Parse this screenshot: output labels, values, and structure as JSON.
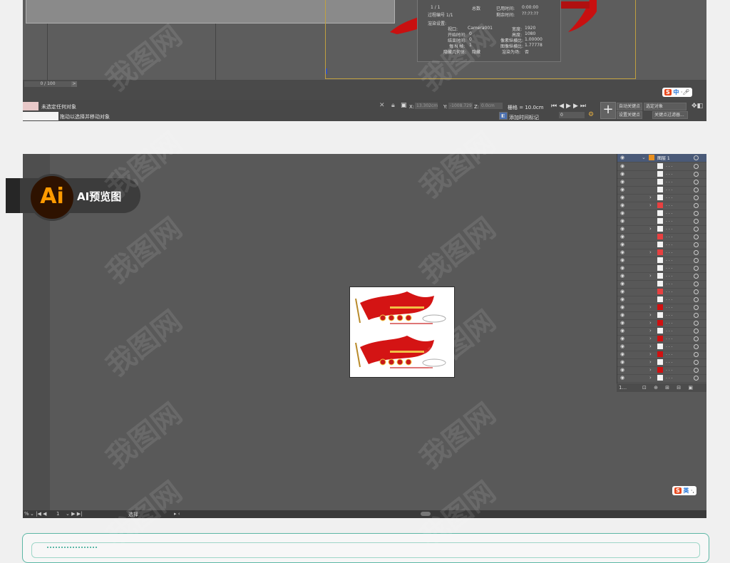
{
  "max": {
    "frame_counter": "0 / 100",
    "frame_arrow": ">",
    "render": {
      "progress_label": "1 / 1",
      "total_label": "总数",
      "elapsed_label": "已用时间:",
      "elapsed_value": "0:00:00",
      "process_frame_label": "过程编号 1/1",
      "remaining_label": "剩余时间:",
      "remaining_value": "??:??:??",
      "settings_title": "渲染设置:",
      "viewport_label": "视口:",
      "viewport_value": "Camera001",
      "width_label": "宽度:",
      "width_value": "1920",
      "start_label": "开始时间:",
      "start_value": "0",
      "height_label": "高度:",
      "height_value": "1080",
      "end_label": "结束时间:",
      "end_value": "0",
      "pixel_aspect_label": "像素纵横比:",
      "pixel_aspect_value": "1.00000",
      "nth_label": "每 N 帧:",
      "nth_value": "1",
      "image_aspect_label": "图像纵横比:",
      "image_aspect_value": "1.77778",
      "hidden_label": "隐藏几何体:",
      "hidden_value": "隐藏",
      "render_atmos_label": "渲染为场:",
      "render_atmos_value": "否"
    },
    "status": {
      "line1": "未选定任何对象",
      "line2": "拖动以选择并移动对象",
      "x_label": "X:",
      "x_value": "13.302cm",
      "y_label": "Y:",
      "y_value": "-1008.729",
      "z_label": "Z:",
      "z_value": "0.0cm",
      "grid_label": "栅格 = 10.0cm",
      "add_time_tag": "添加时间标记",
      "auto_key": "自动关键点",
      "selected_object": "选定对象",
      "set_key": "设置关键点",
      "key_filters": "关键点过滤器...",
      "frame_value": "0",
      "plus": "+"
    },
    "ime": {
      "s": "S",
      "lang": "中"
    }
  },
  "ai": {
    "badge_logo": "Ai",
    "badge_text": "AI预览图",
    "layer_name": "图层 1",
    "layers_count": "1...",
    "status_zoom": "%",
    "status_page": "1",
    "status_tool": "选择",
    "ime": {
      "s": "S",
      "lang": "英"
    }
  },
  "watermark": "我图网"
}
